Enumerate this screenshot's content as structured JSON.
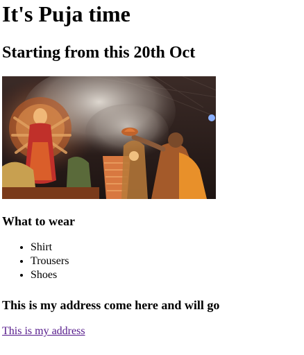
{
  "page": {
    "title": "It's Puja time",
    "subtitle": "Starting from this 20th Oct"
  },
  "photo": {
    "alt": "Durga Puja aarti",
    "colors": {
      "background": "#2a1c1a",
      "smoke": "#d8d0c8",
      "idol": "#c98a4a",
      "saffron": "#d8742a",
      "lamp": "#c0632c"
    }
  },
  "wear": {
    "heading": "What to wear",
    "items": [
      "Shirt",
      "Trousers",
      "Shoes"
    ]
  },
  "address": {
    "heading": "This is my address come here and will go",
    "link_label": "This is my address",
    "link_color": "#551a8b"
  }
}
